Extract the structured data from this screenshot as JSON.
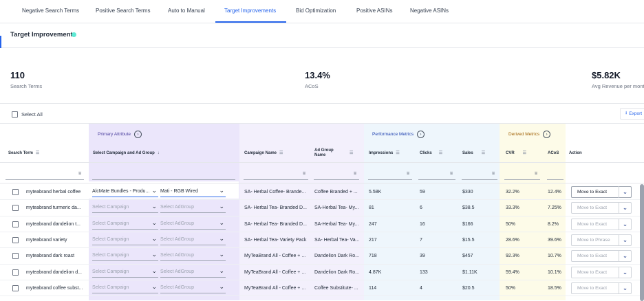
{
  "tabs": [
    {
      "label": "Negative Search Terms"
    },
    {
      "label": "Positive Search Terms"
    },
    {
      "label": "Auto to Manual"
    },
    {
      "label": "Target Improvements"
    },
    {
      "label": "Bid Optimization"
    },
    {
      "label": "Positive ASINs"
    },
    {
      "label": "Negative ASINs"
    }
  ],
  "page_title": "Target Improvements",
  "metrics": [
    {
      "value": "110",
      "label": "Search Terms"
    },
    {
      "value": "13.4%",
      "label": "ACoS"
    },
    {
      "value": "$5.82K",
      "label": "Avg Revenue per mont"
    }
  ],
  "select_all": "Select All",
  "export_label": "Export",
  "groups": {
    "primary": "Primary Attribute",
    "performance": "Performance Metrics",
    "derived": "Derived Metrics"
  },
  "headers": {
    "search_term": "Search Term",
    "select_campaign": "Select Campaign and Ad Group",
    "campaign_name": "Campaign Name",
    "ad_group_name_1": "Ad Group",
    "ad_group_name_2": "Name",
    "impressions": "Impressions",
    "clicks": "Clicks",
    "sales": "Sales",
    "cvr": "CVR",
    "acos": "ACoS",
    "action": "Action"
  },
  "rows": [
    {
      "term": "myteabrand herbal coffee",
      "campaign_select": "AlcMate Bundles - Produ...",
      "adgroup_select": "Mati - RGB Wired",
      "campaign": "SA- Herbal Coffee- Brande...",
      "adgroup": "Coffee Branded + ...",
      "impressions": "5.58K",
      "clicks": "59",
      "sales": "$330",
      "cvr": "32.2%",
      "acos": "12.4%",
      "action": "Move to Exact"
    },
    {
      "term": "myteabrand turmeric da...",
      "campaign_select": "Select Campaign",
      "adgroup_select": "Select AdGroup",
      "campaign": "SA- Herbal Tea- Branded D...",
      "adgroup": "SA-Herbal Tea- My...",
      "impressions": "81",
      "clicks": "6",
      "sales": "$38.5",
      "cvr": "33.3%",
      "acos": "7.25%",
      "action": "Move to Exact"
    },
    {
      "term": "myteabrand dandelion t...",
      "campaign_select": "Select Campaign",
      "adgroup_select": "Select AdGroup",
      "campaign": "SA- Herbal Tea- Branded D...",
      "adgroup": "SA-Herbal Tea- My...",
      "impressions": "247",
      "clicks": "16",
      "sales": "$166",
      "cvr": "50%",
      "acos": "8.2%",
      "action": "Move to Exact"
    },
    {
      "term": "myteabrand variety",
      "campaign_select": "Select Campaign",
      "adgroup_select": "Select AdGroup",
      "campaign": "SA- Herbal Tea- Variety Pack",
      "adgroup": "SA- Herbal Tea- Va...",
      "impressions": "217",
      "clicks": "7",
      "sales": "$15.5",
      "cvr": "28.6%",
      "acos": "39.6%",
      "action": "Move to Phrase"
    },
    {
      "term": "myteabrand dark roast",
      "campaign_select": "Select Campaign",
      "adgroup_select": "Select AdGroup",
      "campaign": "MyTeaBrand All - Coffee + ...",
      "adgroup": "Dandelion Dark Ro...",
      "impressions": "718",
      "clicks": "39",
      "sales": "$457",
      "cvr": "92.3%",
      "acos": "10.7%",
      "action": "Move to Exact"
    },
    {
      "term": "myteabrand dandelion d...",
      "campaign_select": "Select Campaign",
      "adgroup_select": "Select AdGroup",
      "campaign": "MyTeaBrand All - Coffee + ...",
      "adgroup": "Dandelion Dark Ro...",
      "impressions": "4.87K",
      "clicks": "133",
      "sales": "$1.11K",
      "cvr": "59.4%",
      "acos": "10.1%",
      "action": "Move to Exact"
    },
    {
      "term": "myteabrand coffee subst...",
      "campaign_select": "Select Campaign",
      "adgroup_select": "Select AdGroup",
      "campaign": "MyTeaBrand All - Coffee + ...",
      "adgroup": "Coffee Substitute- ...",
      "impressions": "114",
      "clicks": "4",
      "sales": "$20.5",
      "cvr": "50%",
      "acos": "18.5%",
      "action": "Move to Exact"
    }
  ],
  "colors": {
    "accent": "#2563eb",
    "primary_band": "#f3f0fc",
    "performance_band": "#eef6fc",
    "derived_band": "#fdfbe8"
  }
}
